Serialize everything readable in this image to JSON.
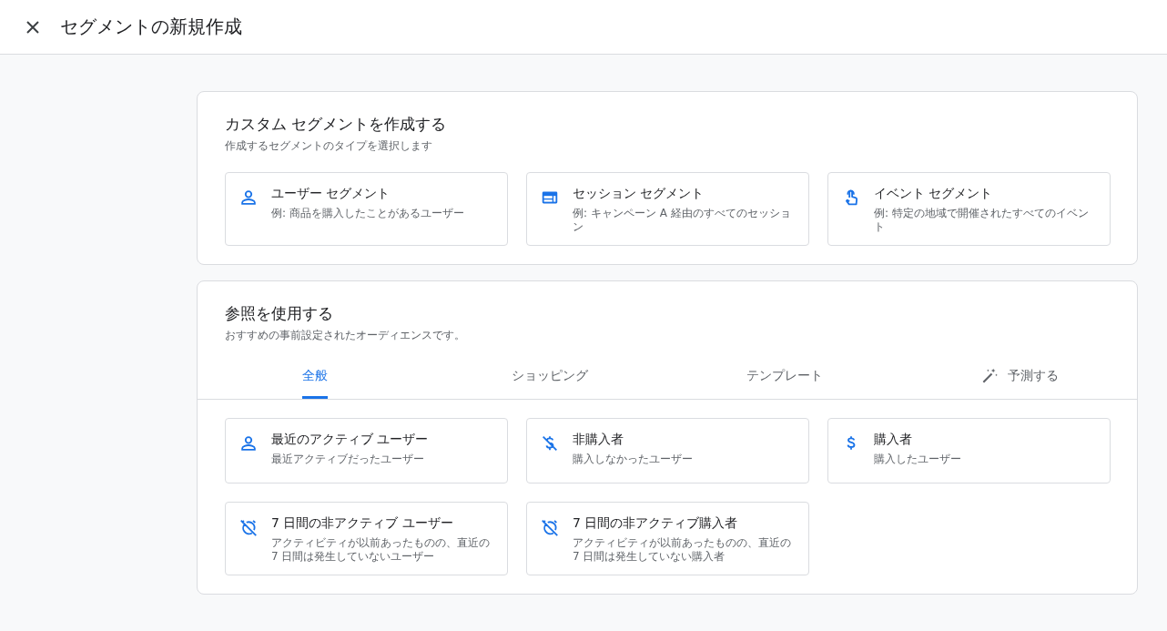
{
  "window": {
    "title": "セグメントの新規作成"
  },
  "custom": {
    "title": "カスタム セグメントを作成する",
    "subtitle": "作成するセグメントのタイプを選択します",
    "cards": [
      {
        "kind": "person",
        "title": "ユーザー セグメント",
        "description": "例: 商品を購入したことがあるユーザー"
      },
      {
        "kind": "session",
        "title": "セッション セグメント",
        "description": "例: キャンペーン A 経由のすべてのセッション"
      },
      {
        "kind": "touch",
        "title": "イベント セグメント",
        "description": "例: 特定の地域で開催されたすべてのイベント"
      }
    ]
  },
  "reference": {
    "title": "参照を使用する",
    "subtitle": "おすすめの事前設定されたオーディエンスです。",
    "tabs": [
      {
        "label": "全般",
        "selected": true
      },
      {
        "label": "ショッピング",
        "selected": false
      },
      {
        "label": "テンプレート",
        "selected": false
      },
      {
        "label": "予測する",
        "selected": false,
        "kind": "wand"
      }
    ],
    "cards": [
      {
        "kind": "person",
        "title": "最近のアクティブ ユーザー",
        "description": "最近アクティブだったユーザー"
      },
      {
        "kind": "no-money",
        "title": "非購入者",
        "description": "購入しなかったユーザー"
      },
      {
        "kind": "dollar",
        "title": "購入者",
        "description": "購入したユーザー"
      },
      {
        "kind": "alarm-off",
        "title": "7 日間の非アクティブ ユーザー",
        "description": "アクティビティが以前あったものの、直近の 7 日間は発生していないユーザー"
      },
      {
        "kind": "alarm-off",
        "title": "7 日間の非アクティブ購入者",
        "description": "アクティビティが以前あったものの、直近の 7 日間は発生していない購入者"
      }
    ]
  }
}
